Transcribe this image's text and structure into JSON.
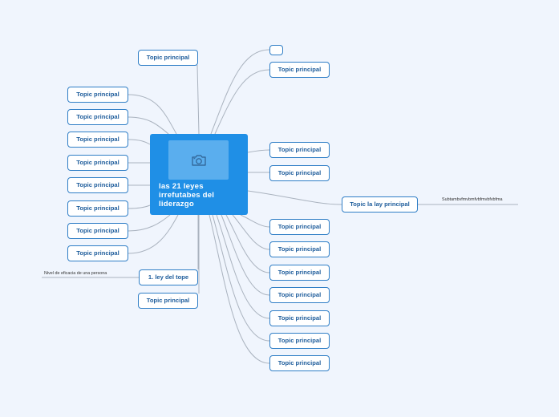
{
  "central": {
    "title": "las 21 leyes irrefutabes del liderazgo",
    "icon": "camera-icon"
  },
  "colors": {
    "central": "#1f8fe6",
    "topic_border": "#2f7ec6",
    "topic_text": "#1d5c9b",
    "line": "#aab3bf",
    "background": "#f0f5fd"
  },
  "left": {
    "top_topic": "Topic principal",
    "topics": [
      "Topic principal",
      "Topic principal",
      "Topic principal",
      "Topic principal",
      "Topic principal",
      "Topic principal",
      "Topic principal",
      "Topic principal"
    ],
    "ley_del_tope": "1. ley del tope",
    "ley_del_tope_subtopic": "Nivel de eficacia de una persona",
    "bottom_topic": "Topic principal"
  },
  "right": {
    "empty_topic": "",
    "topics_top": [
      "Topic principal",
      "Topic principal",
      "Topic principal"
    ],
    "lay_topic": "Topic la lay principal",
    "lay_subtopic": "Subtambvfmvbmfvbfmvbfvbfma",
    "topics_bottom": [
      "Topic principal",
      "Topic principal",
      "Topic principal",
      "Topic principal",
      "Topic principal",
      "Topic principal",
      "Topic principal"
    ]
  }
}
